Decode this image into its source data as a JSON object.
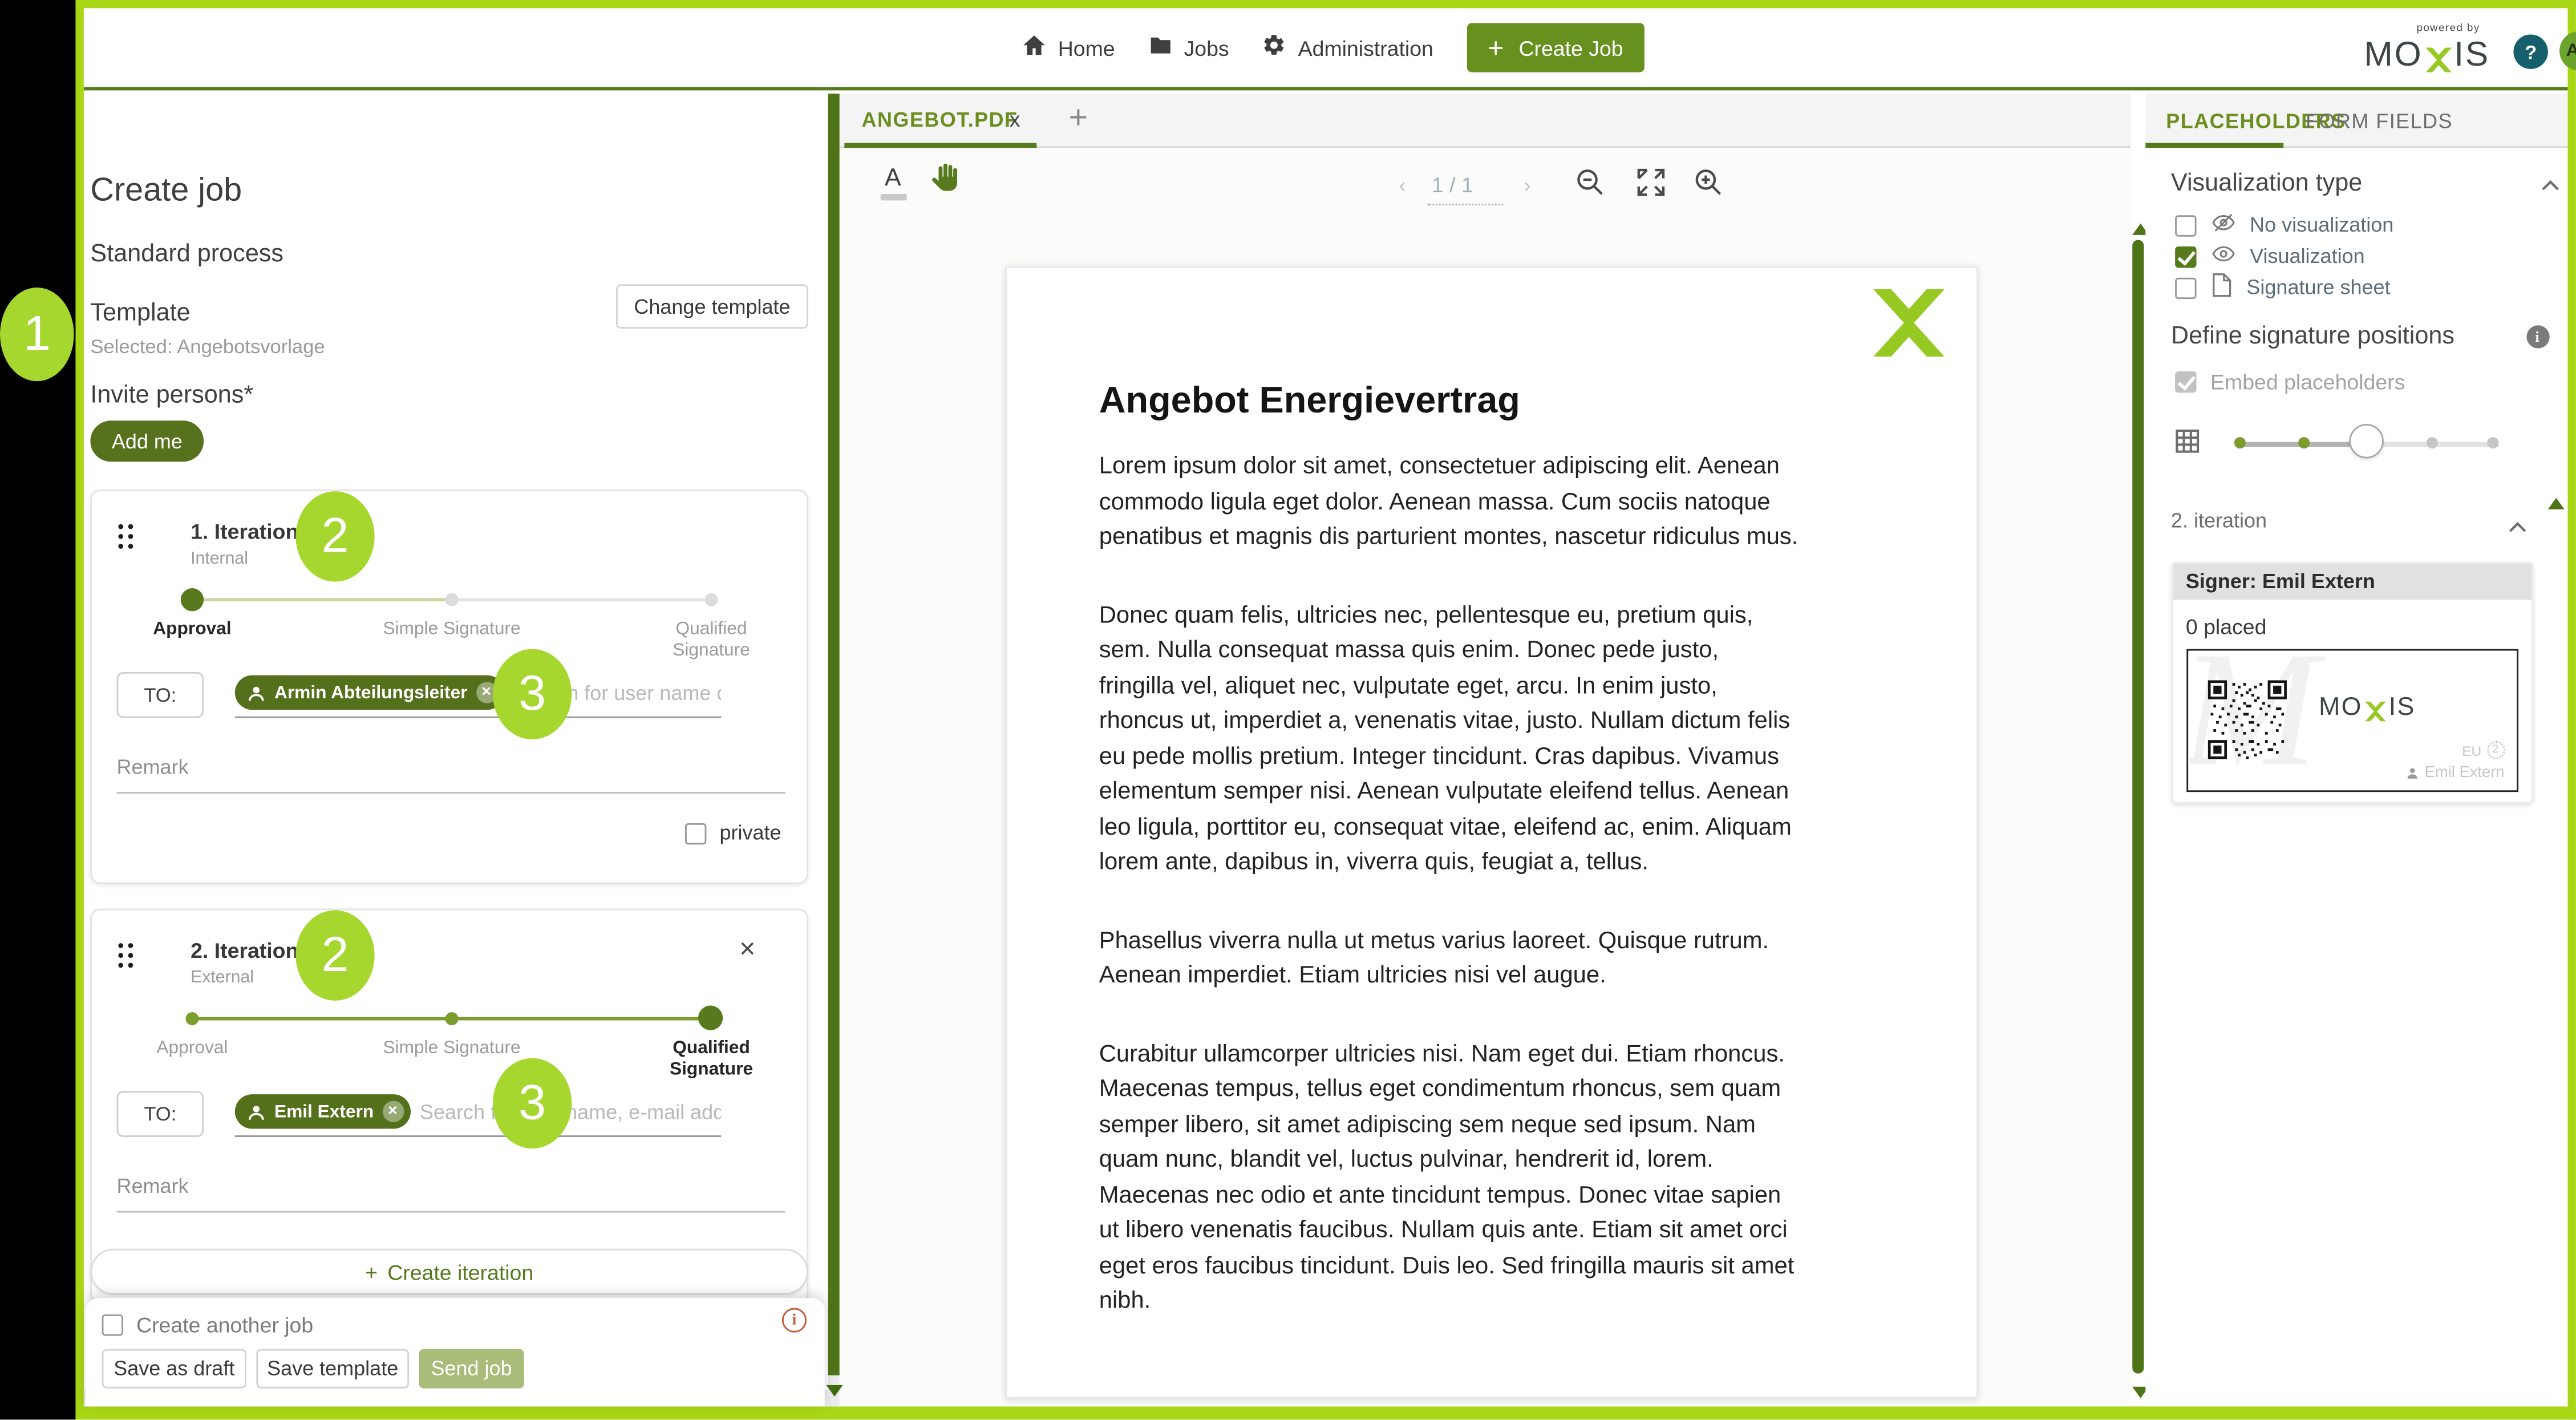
{
  "colors": {
    "accent_dark_green": "#567a1d",
    "lime_border": "#a9d615",
    "annotation_lime": "#a6d72e",
    "chip_green": "#55701b",
    "send_disabled": "#a9bc79",
    "help_teal": "#15606c"
  },
  "header": {
    "nav": [
      {
        "label": "Home"
      },
      {
        "label": "Jobs"
      },
      {
        "label": "Administration"
      }
    ],
    "create_job_label": "Create Job",
    "plus": "+",
    "powered_by": "powered by",
    "logo_mo": "MO",
    "logo_is": "IS",
    "help": "?",
    "avatar": "AH"
  },
  "left": {
    "title": "Create job",
    "process": "Standard process",
    "template_label": "Template",
    "change_template": "Change template",
    "template_selected": "Selected: Angebotsvorlage",
    "invite": "Invite persons*",
    "add_me": "Add me",
    "to_label": "TO:",
    "remark_placeholder": "Remark",
    "steps": [
      "Approval",
      "Simple Signature",
      "Qualified Signature"
    ],
    "iterations": [
      {
        "title": "1. Iteration",
        "scope": "Internal",
        "chip": "Armin Abteilungsleiter",
        "search_placeholder": "Search for user name or e-mail ...",
        "private_label": "private"
      },
      {
        "title": "2. Iteration",
        "scope": "External",
        "chip": "Emil Extern",
        "search_placeholder": "Search for user name, e-mail address o..."
      }
    ],
    "chip_remove": "×",
    "close": "×",
    "plus": "+",
    "create_iteration": "Create iteration",
    "footer": {
      "create_another": "Create another job",
      "save_draft": "Save as draft",
      "save_template": "Save template",
      "send": "Send job",
      "info": "i"
    }
  },
  "annotations": {
    "n1": "1",
    "n2": "2",
    "n3": "3"
  },
  "pdf": {
    "tab": "ANGEBOT.PDF",
    "close": "x",
    "new_tab": "+",
    "page_indicator": "1 / 1",
    "doc": {
      "title": "Angebot Energievertrag",
      "p1": "Lorem ipsum dolor sit amet, consectetuer adipiscing elit. Aenean commodo ligula eget dolor. Aenean massa. Cum sociis natoque penatibus et magnis dis parturient montes, nascetur ridiculus mus.",
      "p2": "Donec quam felis, ultricies nec, pellentesque eu, pretium quis, sem. Nulla consequat massa quis enim. Donec pede justo, fringilla vel, aliquet nec, vulputate eget, arcu. In enim justo, rhoncus ut, imperdiet a, venenatis vitae, justo. Nullam dictum felis eu pede mollis pretium. Integer tincidunt. Cras dapibus. Vivamus elementum semper nisi. Aenean vulputate eleifend tellus. Aenean leo ligula, porttitor eu, consequat vitae, eleifend ac, enim. Aliquam lorem ante, dapibus in, viverra quis, feugiat a, tellus.",
      "p3": "Phasellus viverra nulla ut metus varius laoreet. Quisque rutrum. Aenean imperdiet. Etiam ultricies nisi vel augue.",
      "p4": "Curabitur ullamcorper ultricies nisi. Nam eget dui. Etiam rhoncus. Maecenas tempus, tellus eget condimentum rhoncus, sem quam semper libero, sit amet adipiscing sem neque sed ipsum. Nam quam nunc, blandit vel, luctus pulvinar, hendrerit id, lorem. Maecenas nec odio et ante tincidunt tempus. Donec vitae sapien ut libero venenatis faucibus. Nullam quis ante. Etiam sit amet orci eget eros faucibus tincidunt. Duis leo. Sed fringilla mauris sit amet nibh."
    }
  },
  "right": {
    "tabs": [
      {
        "label": "PLACEHOLDERS"
      },
      {
        "label": "FORM FIELDS"
      }
    ],
    "viz_title": "Visualization type",
    "options": [
      {
        "label": "No visualization"
      },
      {
        "label": "Visualization"
      },
      {
        "label": "Signature sheet"
      }
    ],
    "define_title": "Define signature positions",
    "info": "i",
    "embed_label": "Embed placeholders",
    "iteration_label": "2. iteration",
    "signer_header": "Signer: Emil Extern",
    "placed": "0 placed",
    "brand_mo": "MO",
    "brand_is": "IS",
    "eu": "EU",
    "eu_num": "2",
    "signer_name": "Emil Extern"
  }
}
